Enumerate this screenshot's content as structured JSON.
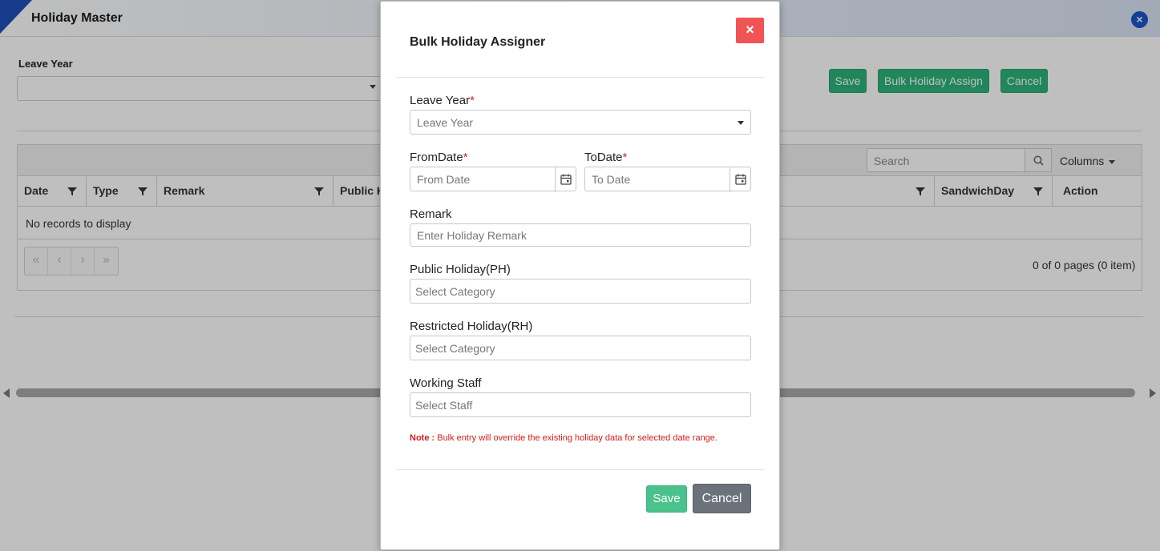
{
  "page": {
    "title": "Holiday Master",
    "leave_year_label": "Leave Year",
    "buttons": {
      "save": "Save",
      "bulk_assign": "Bulk Holiday Assign",
      "cancel": "Cancel"
    },
    "grid": {
      "search_placeholder": "Search",
      "columns_label": "Columns",
      "headers": [
        "Date",
        "Type",
        "Remark",
        "Public H",
        "SandwichDay",
        "Action"
      ],
      "empty_message": "No records to display",
      "pager_info": "0 of 0 pages (0 item)",
      "pager_buttons": [
        "«",
        "‹",
        "›",
        "»"
      ]
    }
  },
  "modal": {
    "title": "Bulk Holiday Assigner",
    "leave_year": {
      "label": "Leave Year",
      "required": "*",
      "placeholder": "Leave Year"
    },
    "from_date": {
      "label": "FromDate",
      "required": "*",
      "placeholder": "From Date"
    },
    "to_date": {
      "label": "ToDate",
      "required": "*",
      "placeholder": "To Date"
    },
    "remark": {
      "label": "Remark",
      "placeholder": "Enter Holiday Remark"
    },
    "public_holiday": {
      "label": "Public Holiday(PH)",
      "placeholder": "Select Category"
    },
    "restricted_holiday": {
      "label": "Restricted Holiday(RH)",
      "placeholder": "Select Category"
    },
    "working_staff": {
      "label": "Working Staff",
      "placeholder": "Select Staff"
    },
    "note": {
      "prefix": "Note :",
      "text": " Bulk entry will override the existing holiday data for selected date range."
    },
    "buttons": {
      "save": "Save",
      "cancel": "Cancel",
      "close": "×"
    }
  },
  "colors": {
    "green": "#2db37a",
    "modal_save": "#49c28c",
    "modal_cancel": "#6c7279",
    "close_red": "#f05454",
    "required_red": "#e02020",
    "accent_blue": "#1a56c4"
  },
  "icons": {
    "close": "close-icon",
    "calendar": "calendar-icon",
    "filter": "filter-icon",
    "search": "search-icon"
  }
}
